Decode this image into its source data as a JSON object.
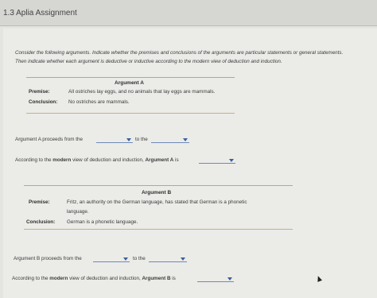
{
  "header": {
    "title": "1.3 Aplia Assignment"
  },
  "instructions": {
    "line1": "Consider the following arguments. Indicate whether the premises and conclusions of the arguments are particular statements or general statements.",
    "line2": "Then indicate whether each argument is deductive or inductive according to the modern view of deduction and induction."
  },
  "argument_a": {
    "title": "Argument A",
    "premise_label": "Premise:",
    "premise_text": "All ostriches lay eggs, and no animals that lay eggs are mammals.",
    "conclusion_label": "Conclusion:",
    "conclusion_text": "No ostriches are mammals.",
    "proceeds_prefix": "Argument A proceeds from the",
    "to_the": "to the",
    "modern_prefix": "According to the",
    "modern_word": "modern",
    "modern_mid": "view of deduction and induction,",
    "modern_arg": "Argument A",
    "modern_is": "is",
    "dropdown_values": [
      "",
      "",
      ""
    ]
  },
  "argument_b": {
    "title": "Argument B",
    "premise_label": "Premise:",
    "premise_text_1": "Fritz, an authority on the German language, has stated that German is a phonetic",
    "premise_text_2": "language.",
    "conclusion_label": "Conclusion:",
    "conclusion_text": "German is a phonetic language.",
    "proceeds_prefix": "Argument B proceeds from the",
    "to_the": "to the",
    "modern_prefix": "According to the",
    "modern_word": "modern",
    "modern_mid": "view of deduction and induction,",
    "modern_arg": "Argument B",
    "modern_is": "is",
    "dropdown_values": [
      "",
      "",
      ""
    ]
  },
  "colors": {
    "dropdown_accent": "#3a5fa0",
    "rule_gold": "#c9b27a"
  }
}
